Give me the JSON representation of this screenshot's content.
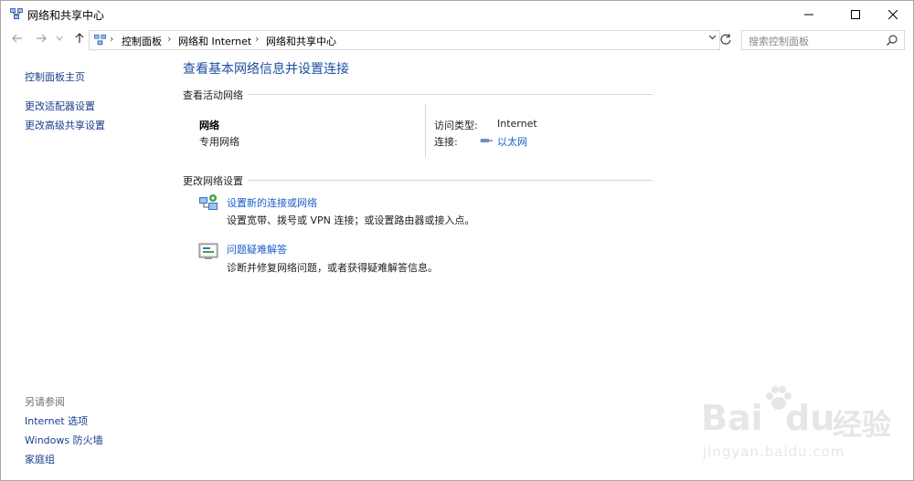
{
  "window": {
    "title": "网络和共享中心",
    "minimize_icon": "minimize-icon",
    "maximize_icon": "maximize-icon",
    "close_icon": "close-icon"
  },
  "navigation": {
    "back_icon": "arrow-left-icon",
    "forward_icon": "arrow-right-icon",
    "recent_icon": "chevron-down-icon",
    "up_icon": "arrow-up-icon"
  },
  "address_bar": {
    "breadcrumbs": [
      "控制面板",
      "网络和 Internet",
      "网络和共享中心"
    ],
    "separator": "›",
    "dropdown_icon": "chevron-down-icon",
    "refresh_icon": "refresh-icon"
  },
  "search": {
    "placeholder": "搜索控制面板",
    "icon": "search-icon"
  },
  "sidebar": {
    "top_links": [
      "控制面板主页",
      "更改适配器设置",
      "更改高级共享设置"
    ],
    "see_also_heading": "另请参阅",
    "see_also_links": [
      "Internet 选项",
      "Windows 防火墙",
      "家庭组"
    ]
  },
  "main": {
    "title": "查看基本网络信息并设置连接",
    "active_networks_heading": "查看活动网络",
    "network": {
      "name": "网络",
      "type": "专用网络",
      "access_type_label": "访问类型:",
      "access_type_value": "Internet",
      "connections_label": "连接:",
      "connection_link": "以太网",
      "connection_icon": "ethernet-icon"
    },
    "change_settings_heading": "更改网络设置",
    "tasks": [
      {
        "icon": "new-connection-icon",
        "link": "设置新的连接或网络",
        "description": "设置宽带、拨号或 VPN 连接；或设置路由器或接入点。"
      },
      {
        "icon": "troubleshoot-icon",
        "link": "问题疑难解答",
        "description": "诊断并修复网络问题，或者获得疑难解答信息。"
      }
    ]
  },
  "watermark": {
    "brand_latin_1": "Bai",
    "brand_latin_2": "du",
    "brand_cn": "经验",
    "url": "jingyan.baidu.com"
  }
}
